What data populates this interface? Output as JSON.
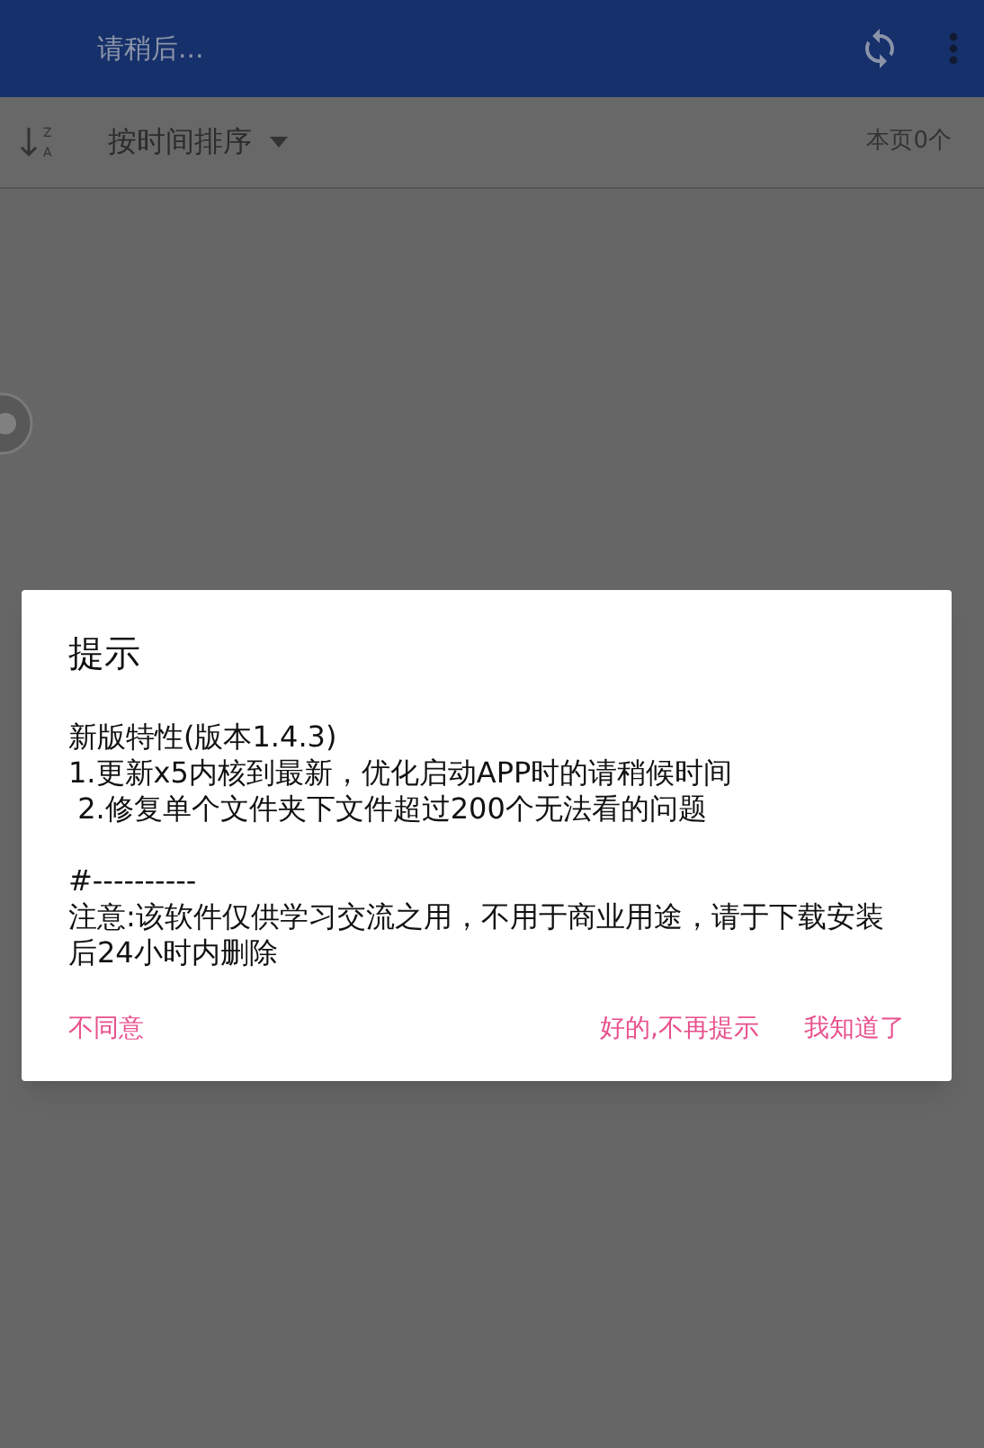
{
  "app_bar": {
    "title": "请稍后..."
  },
  "sort_bar": {
    "icon_letters": [
      "Z",
      "A"
    ],
    "label": "按时间排序",
    "count": "本页0个"
  },
  "dialog": {
    "title": "提示",
    "paragraphs": [
      [
        "新版特性(版本1.4.3)",
        "1.更新x5内核到最新，优化启动APP时的请稍候时间",
        " 2.修复单个文件夹下文件超过200个无法看的问题"
      ],
      [
        "#----------",
        "注意:该软件仅供学习交流之用，不用于商业用途，请于下载安装后24小时内删除"
      ]
    ],
    "buttons": [
      {
        "label": "不同意",
        "kind": "dismiss"
      },
      {
        "label": "好的,不再提示",
        "kind": "action"
      },
      {
        "label": "我知道了",
        "kind": "action"
      }
    ]
  }
}
